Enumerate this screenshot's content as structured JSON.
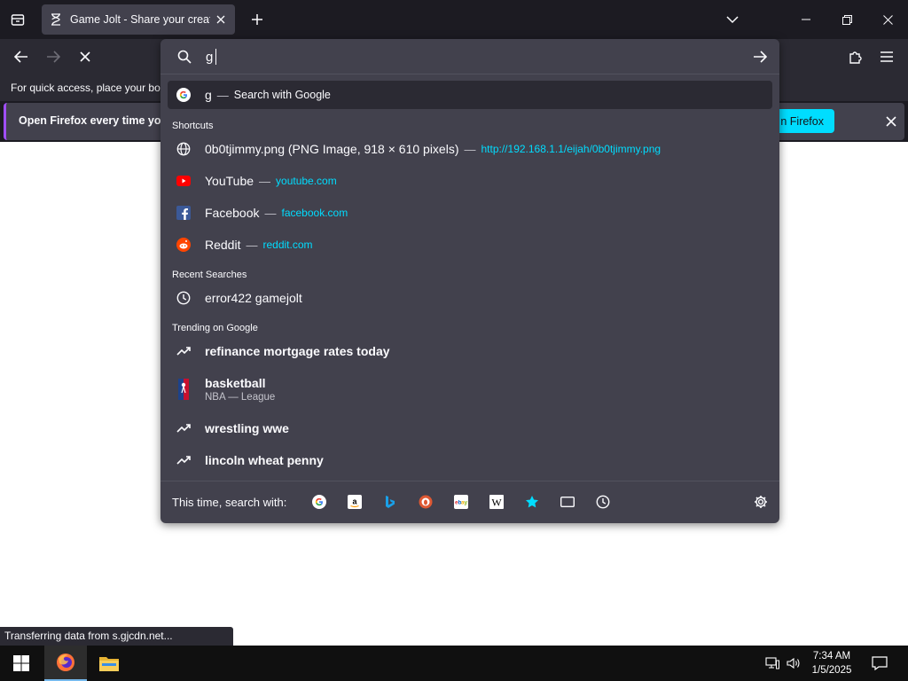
{
  "tabs": [
    {
      "title": "Game Jolt - Share your creations",
      "active": true
    }
  ],
  "bookmarks_hint": "For quick access, place your boo",
  "notification": {
    "text": "Open Firefox every time you",
    "button_label": "n Firefox"
  },
  "urlbar": {
    "query": "g",
    "first_result": {
      "text": "g",
      "separator": "—",
      "action": "Search with Google"
    },
    "shortcuts_label": "Shortcuts",
    "shortcuts": [
      {
        "icon": "globe-icon",
        "title": "0b0tjimmy.png (PNG Image, 918 × 610 pixels)",
        "url": "http://192.168.1.1/eijah/0b0tjimmy.png"
      },
      {
        "icon": "youtube-icon",
        "title": "YouTube",
        "url": "youtube.com"
      },
      {
        "icon": "facebook-icon",
        "title": "Facebook",
        "url": "facebook.com"
      },
      {
        "icon": "reddit-icon",
        "title": "Reddit",
        "url": "reddit.com"
      }
    ],
    "recent_label": "Recent Searches",
    "recent": [
      {
        "icon": "history-icon",
        "title": "error422 gamejolt"
      }
    ],
    "trending_label": "Trending on Google",
    "trending": [
      {
        "icon": "trending-icon",
        "title": "refinance mortgage rates today",
        "subtitle": ""
      },
      {
        "icon": "nba-icon",
        "title": "basketball",
        "subtitle": "NBA — League"
      },
      {
        "icon": "trending-icon",
        "title": "wrestling wwe",
        "subtitle": ""
      },
      {
        "icon": "trending-icon",
        "title": "lincoln wheat penny",
        "subtitle": ""
      }
    ],
    "oneoff_label": "This time, search with:",
    "engines": [
      "google-icon",
      "amazon-icon",
      "bing-icon",
      "duckduckgo-icon",
      "ebay-icon",
      "wikipedia-icon",
      "bookmarks-star-icon",
      "tabs-icon",
      "history-icon"
    ]
  },
  "status_text": "Transferring data from s.gjcdn.net...",
  "clock": {
    "time": "7:34 AM",
    "date": "1/5/2025"
  },
  "colors": {
    "accent": "#00ddff",
    "panel": "#42414d",
    "toolbar": "#2b2a33",
    "frame": "#1c1b22"
  }
}
